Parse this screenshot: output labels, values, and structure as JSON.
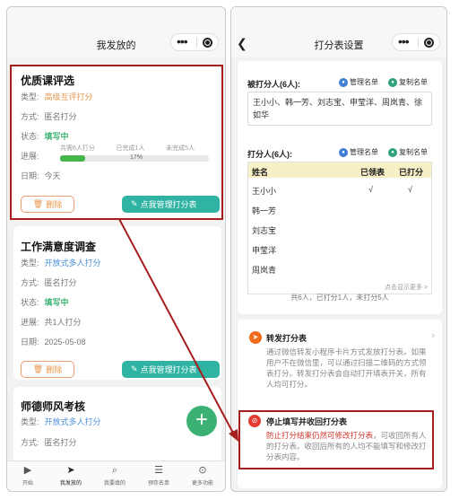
{
  "left": {
    "nav_title": "我发放的",
    "cards": [
      {
        "title": "优质课评选",
        "type_label": "类型:",
        "type_value": "高级互评打分",
        "mode_label": "方式:",
        "mode_value": "匿名打分",
        "status_label": "状态:",
        "status_value": "填写中",
        "progress_label": "进展:",
        "progress_items": [
          "共需6人打分",
          "已完成1人",
          "未完成5人"
        ],
        "progress_fraction": 0.17,
        "progress_pct_text": "17%",
        "date_label": "日期:",
        "date_value": "今天",
        "delete_label": "删除",
        "manage_label": "点我管理打分表"
      },
      {
        "title": "工作满意度调查",
        "type_label": "类型:",
        "type_value": "开放式多人打分",
        "mode_label": "方式:",
        "mode_value": "匿名打分",
        "status_label": "状态:",
        "status_value": "填写中",
        "progress_label": "进展:",
        "progress_value": "共1人打分",
        "date_label": "日期:",
        "date_value": "2025-05-08",
        "delete_label": "删除",
        "manage_label": "点我管理打分表"
      },
      {
        "title": "师德师风考核",
        "type_label": "类型:",
        "type_value": "开放式多人打分",
        "mode_label": "方式:",
        "mode_value": "匿名打分"
      }
    ],
    "fab_label": "+",
    "tabs": [
      {
        "label": "开始",
        "icon": "play-icon"
      },
      {
        "label": "我发放的",
        "icon": "send-icon"
      },
      {
        "label": "我要填的",
        "icon": "search-icon"
      },
      {
        "label": "预存名单",
        "icon": "list-icon"
      },
      {
        "label": "更多功能",
        "icon": "more-icon"
      }
    ]
  },
  "right": {
    "nav_title": "打分表设置",
    "rated": {
      "title": "被打分人(6人):",
      "manage_label": "管理名单",
      "copy_label": "复制名单",
      "names": "王小小、韩一芳、刘志宝、申莹洋、周岚青、徐如华"
    },
    "raters": {
      "title": "打分人(6人):",
      "manage_label": "管理名单",
      "copy_label": "复制名单",
      "headers": [
        "姓名",
        "已领表",
        "已打分"
      ],
      "rows": [
        {
          "name": "王小小",
          "received": "√",
          "scored": "√"
        },
        {
          "name": "韩一芳",
          "received": "",
          "scored": ""
        },
        {
          "name": "刘志宝",
          "received": "",
          "scored": ""
        },
        {
          "name": "申莹洋",
          "received": "",
          "scored": ""
        },
        {
          "name": "周岚青",
          "received": "",
          "scored": ""
        }
      ],
      "more_label": "点击显示更多 >",
      "summary": "共6人，已打分1人，未打分5人"
    },
    "forward": {
      "title": "转发打分表",
      "desc": "通过微信转发小程序卡片方式发放打分表。如果用户不在微信里，可以通过扫描二维码的方式领表打分。转发打分表会自动打开填表开关，所有人均可打分。"
    },
    "stop": {
      "title": "停止填写并收回打分表",
      "desc_red": "防止打分结束仍然可修改打分表",
      "desc_rest": "，可收回所有人的打分表。收回后所有的人均不能填写和修改打分表内容。"
    }
  },
  "colors": {
    "accent_green": "#3bb273",
    "teal_button": "#2fb3a3",
    "orange": "#e8954b",
    "blue": "#4a90d9",
    "highlight_red": "#a61d1d"
  }
}
